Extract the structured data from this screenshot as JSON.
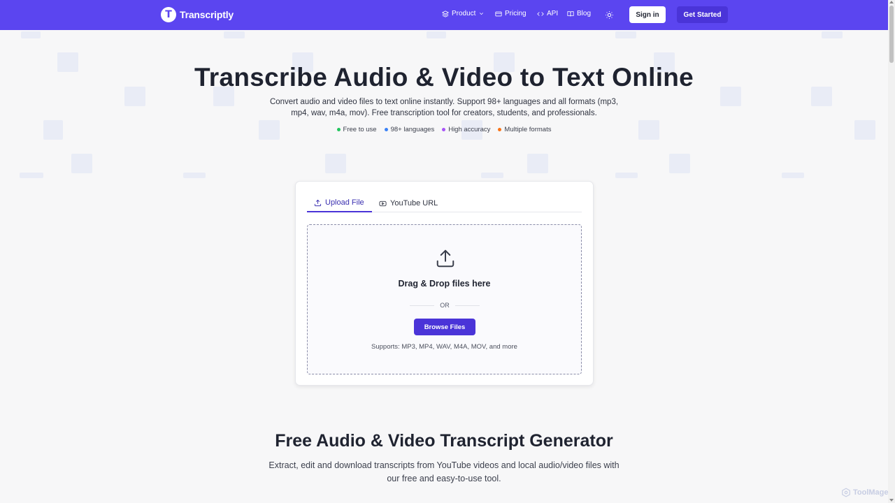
{
  "header": {
    "logo_letter": "T",
    "brand": "Transcriptly",
    "nav": [
      {
        "label": "Product",
        "icon": "layers-icon",
        "dropdown": true
      },
      {
        "label": "Pricing",
        "icon": "card-icon"
      },
      {
        "label": "API",
        "icon": "code-icon"
      },
      {
        "label": "Blog",
        "icon": "book-icon"
      }
    ],
    "theme_icon": "sun-icon",
    "signin_label": "Sign in",
    "get_started_label": "Get Started"
  },
  "hero": {
    "title": "Transcribe Audio & Video to Text Online",
    "description": "Convert audio and video files to text online instantly. Support 98+ languages and all formats (mp3, mp4, wav, m4a, mov). Free transcription tool for creators, students, and professionals.",
    "features": [
      {
        "label": "Free to use",
        "color": "#22c55e"
      },
      {
        "label": "98+ languages",
        "color": "#3b82f6"
      },
      {
        "label": "High accuracy",
        "color": "#a855f7"
      },
      {
        "label": "Multiple formats",
        "color": "#f97316"
      }
    ]
  },
  "upload_card": {
    "tabs": [
      {
        "label": "Upload File",
        "icon": "upload-icon",
        "active": true
      },
      {
        "label": "YouTube URL",
        "icon": "play-icon",
        "active": false
      }
    ],
    "dropzone_title": "Drag & Drop files here",
    "or_label": "OR",
    "browse_label": "Browse Files",
    "supports_text": "Supports: MP3, MP4, WAV, M4A, MOV, and more"
  },
  "section": {
    "title": "Free Audio & Video Transcript Generator",
    "description": "Extract, edit and download transcripts from YouTube videos and local audio/video files with our free and easy-to-use tool."
  },
  "watermark": "ToolMage",
  "colors": {
    "brand": "#5b45f0",
    "button": "#4a34d8",
    "background": "#f7f7f8"
  }
}
